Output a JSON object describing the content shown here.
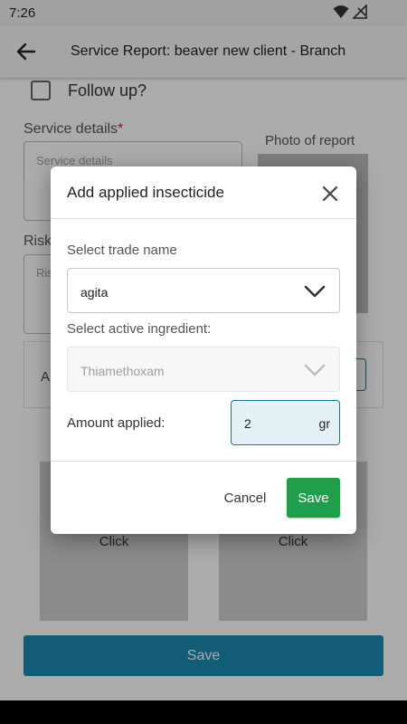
{
  "status_bar": {
    "time": "7:26",
    "wifi_icon": "wifi-icon",
    "signal_icon": "signal-off-icon"
  },
  "app_bar": {
    "title": "Service Report: beaver new client - Branch",
    "back_icon": "arrow-back-icon"
  },
  "form": {
    "follow_up_label": "Follow up?",
    "service_details_label": "Service details",
    "required_mark": "*",
    "service_details_placeholder": "Service details",
    "photo_label": "Photo of report",
    "risk_label": "Risk",
    "risk_placeholder": "Ris",
    "insecticide_row_label": "A",
    "click_label_1": "Click",
    "click_label_2": "Click",
    "save_label": "Save"
  },
  "dialog": {
    "title": "Add applied insecticide",
    "close_icon": "close-icon",
    "trade_name_label": "Select trade name",
    "trade_name_value": "agita",
    "active_ingredient_label": "Select active ingredient:",
    "active_ingredient_value": "Thiamethoxam",
    "amount_label": "Amount applied:",
    "amount_value": "2",
    "amount_unit": "gr",
    "cancel_label": "Cancel",
    "save_label": "Save"
  },
  "colors": {
    "primary": "#1a8ab0",
    "save_green": "#1f9e4b",
    "required_red": "#c62828",
    "input_focus": "#1b7a98"
  }
}
